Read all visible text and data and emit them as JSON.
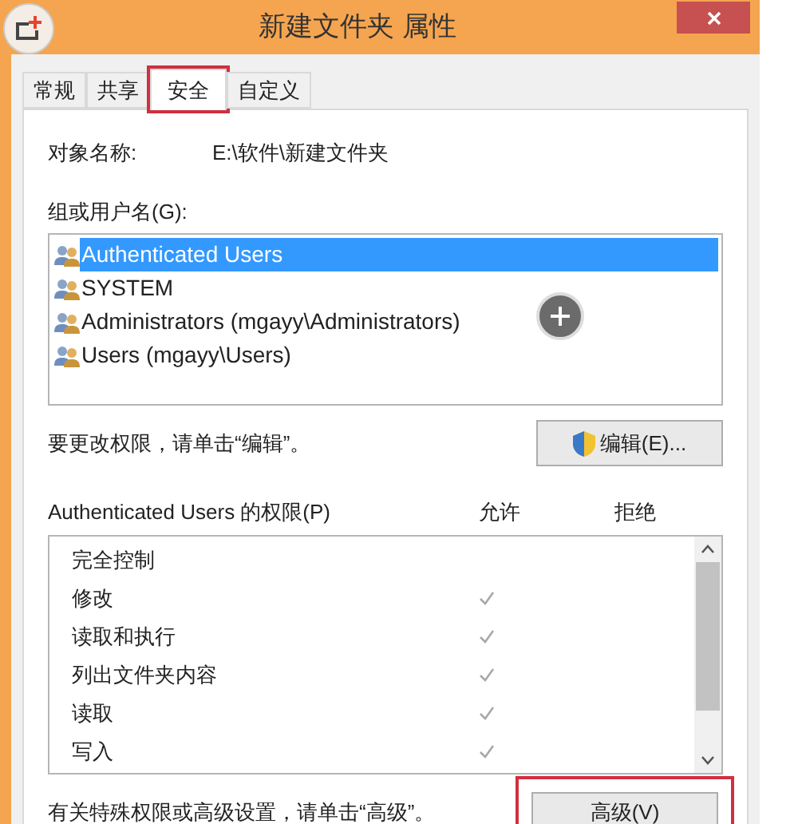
{
  "window": {
    "title": "新建文件夹 属性"
  },
  "tabs": [
    {
      "label": "常规",
      "selected": false,
      "highlighted": false
    },
    {
      "label": "共享",
      "selected": false,
      "highlighted": false
    },
    {
      "label": "安全",
      "selected": true,
      "highlighted": true
    },
    {
      "label": "自定义",
      "selected": false,
      "highlighted": false
    }
  ],
  "object_name": {
    "label": "对象名称:",
    "value": "E:\\软件\\新建文件夹"
  },
  "groups": {
    "label": "组或用户名(G):",
    "items": [
      {
        "name": "Authenticated Users",
        "selected": true
      },
      {
        "name": "SYSTEM",
        "selected": false
      },
      {
        "name": "Administrators (mgayy\\Administrators)",
        "selected": false
      },
      {
        "name": "Users (mgayy\\Users)",
        "selected": false
      }
    ]
  },
  "edit_hint": "要更改权限，请单击“编辑”。",
  "edit_button": "编辑(E)...",
  "permissions": {
    "label": "Authenticated Users 的权限(P)",
    "allow_header": "允许",
    "deny_header": "拒绝",
    "rows": [
      {
        "name": "完全控制",
        "allow": false,
        "deny": false
      },
      {
        "name": "修改",
        "allow": true,
        "deny": false
      },
      {
        "name": "读取和执行",
        "allow": true,
        "deny": false
      },
      {
        "name": "列出文件夹内容",
        "allow": true,
        "deny": false
      },
      {
        "name": "读取",
        "allow": true,
        "deny": false
      },
      {
        "name": "写入",
        "allow": true,
        "deny": false
      }
    ]
  },
  "advanced_hint": "有关特殊权限或高级设置，请单击“高级”。",
  "advanced_button": {
    "label": "高级(V)",
    "highlighted": true
  }
}
